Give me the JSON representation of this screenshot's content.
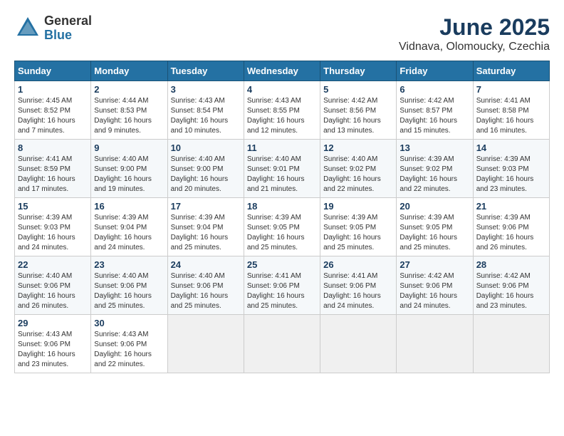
{
  "header": {
    "logo_general": "General",
    "logo_blue": "Blue",
    "month_title": "June 2025",
    "subtitle": "Vidnava, Olomoucky, Czechia"
  },
  "days_of_week": [
    "Sunday",
    "Monday",
    "Tuesday",
    "Wednesday",
    "Thursday",
    "Friday",
    "Saturday"
  ],
  "weeks": [
    [
      {
        "day": "1",
        "info": "Sunrise: 4:45 AM\nSunset: 8:52 PM\nDaylight: 16 hours and 7 minutes."
      },
      {
        "day": "2",
        "info": "Sunrise: 4:44 AM\nSunset: 8:53 PM\nDaylight: 16 hours and 9 minutes."
      },
      {
        "day": "3",
        "info": "Sunrise: 4:43 AM\nSunset: 8:54 PM\nDaylight: 16 hours and 10 minutes."
      },
      {
        "day": "4",
        "info": "Sunrise: 4:43 AM\nSunset: 8:55 PM\nDaylight: 16 hours and 12 minutes."
      },
      {
        "day": "5",
        "info": "Sunrise: 4:42 AM\nSunset: 8:56 PM\nDaylight: 16 hours and 13 minutes."
      },
      {
        "day": "6",
        "info": "Sunrise: 4:42 AM\nSunset: 8:57 PM\nDaylight: 16 hours and 15 minutes."
      },
      {
        "day": "7",
        "info": "Sunrise: 4:41 AM\nSunset: 8:58 PM\nDaylight: 16 hours and 16 minutes."
      }
    ],
    [
      {
        "day": "8",
        "info": "Sunrise: 4:41 AM\nSunset: 8:59 PM\nDaylight: 16 hours and 17 minutes."
      },
      {
        "day": "9",
        "info": "Sunrise: 4:40 AM\nSunset: 9:00 PM\nDaylight: 16 hours and 19 minutes."
      },
      {
        "day": "10",
        "info": "Sunrise: 4:40 AM\nSunset: 9:00 PM\nDaylight: 16 hours and 20 minutes."
      },
      {
        "day": "11",
        "info": "Sunrise: 4:40 AM\nSunset: 9:01 PM\nDaylight: 16 hours and 21 minutes."
      },
      {
        "day": "12",
        "info": "Sunrise: 4:40 AM\nSunset: 9:02 PM\nDaylight: 16 hours and 22 minutes."
      },
      {
        "day": "13",
        "info": "Sunrise: 4:39 AM\nSunset: 9:02 PM\nDaylight: 16 hours and 22 minutes."
      },
      {
        "day": "14",
        "info": "Sunrise: 4:39 AM\nSunset: 9:03 PM\nDaylight: 16 hours and 23 minutes."
      }
    ],
    [
      {
        "day": "15",
        "info": "Sunrise: 4:39 AM\nSunset: 9:03 PM\nDaylight: 16 hours and 24 minutes."
      },
      {
        "day": "16",
        "info": "Sunrise: 4:39 AM\nSunset: 9:04 PM\nDaylight: 16 hours and 24 minutes."
      },
      {
        "day": "17",
        "info": "Sunrise: 4:39 AM\nSunset: 9:04 PM\nDaylight: 16 hours and 25 minutes."
      },
      {
        "day": "18",
        "info": "Sunrise: 4:39 AM\nSunset: 9:05 PM\nDaylight: 16 hours and 25 minutes."
      },
      {
        "day": "19",
        "info": "Sunrise: 4:39 AM\nSunset: 9:05 PM\nDaylight: 16 hours and 25 minutes."
      },
      {
        "day": "20",
        "info": "Sunrise: 4:39 AM\nSunset: 9:05 PM\nDaylight: 16 hours and 25 minutes."
      },
      {
        "day": "21",
        "info": "Sunrise: 4:39 AM\nSunset: 9:06 PM\nDaylight: 16 hours and 26 minutes."
      }
    ],
    [
      {
        "day": "22",
        "info": "Sunrise: 4:40 AM\nSunset: 9:06 PM\nDaylight: 16 hours and 26 minutes."
      },
      {
        "day": "23",
        "info": "Sunrise: 4:40 AM\nSunset: 9:06 PM\nDaylight: 16 hours and 25 minutes."
      },
      {
        "day": "24",
        "info": "Sunrise: 4:40 AM\nSunset: 9:06 PM\nDaylight: 16 hours and 25 minutes."
      },
      {
        "day": "25",
        "info": "Sunrise: 4:41 AM\nSunset: 9:06 PM\nDaylight: 16 hours and 25 minutes."
      },
      {
        "day": "26",
        "info": "Sunrise: 4:41 AM\nSunset: 9:06 PM\nDaylight: 16 hours and 24 minutes."
      },
      {
        "day": "27",
        "info": "Sunrise: 4:42 AM\nSunset: 9:06 PM\nDaylight: 16 hours and 24 minutes."
      },
      {
        "day": "28",
        "info": "Sunrise: 4:42 AM\nSunset: 9:06 PM\nDaylight: 16 hours and 23 minutes."
      }
    ],
    [
      {
        "day": "29",
        "info": "Sunrise: 4:43 AM\nSunset: 9:06 PM\nDaylight: 16 hours and 23 minutes."
      },
      {
        "day": "30",
        "info": "Sunrise: 4:43 AM\nSunset: 9:06 PM\nDaylight: 16 hours and 22 minutes."
      },
      {
        "day": "",
        "info": ""
      },
      {
        "day": "",
        "info": ""
      },
      {
        "day": "",
        "info": ""
      },
      {
        "day": "",
        "info": ""
      },
      {
        "day": "",
        "info": ""
      }
    ]
  ]
}
